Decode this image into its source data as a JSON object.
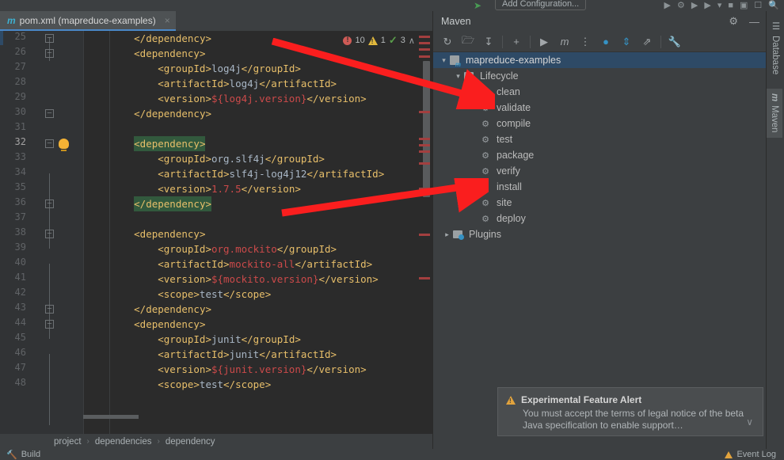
{
  "toolbar": {
    "run_config_label": "Add Configuration...",
    "icons": [
      "run-icon",
      "debug-icon",
      "coverage-icon",
      "profile-icon",
      "dropdown-icon",
      "stop-icon",
      "layout-icon",
      "update-icon",
      "search-icon"
    ]
  },
  "editor": {
    "tab": {
      "icon": "m",
      "title": "pom.xml (mapreduce-examples)",
      "close": "×"
    },
    "inspections": {
      "errors": "10",
      "warnings": "1",
      "checks": "3",
      "up": "∧",
      "down": "∨"
    },
    "first_line": 25,
    "lines": [
      {
        "n": 25,
        "indent": 2,
        "text": "</dependency>"
      },
      {
        "n": 26,
        "indent": 2,
        "text": "<dependency>"
      },
      {
        "n": 27,
        "indent": 3,
        "text": "<groupId>log4j</groupId>"
      },
      {
        "n": 28,
        "indent": 3,
        "text": "<artifactId>log4j</artifactId>"
      },
      {
        "n": 29,
        "indent": 3,
        "text": "<version>${log4j.version}</version>"
      },
      {
        "n": 30,
        "indent": 2,
        "text": "</dependency>"
      },
      {
        "n": 31,
        "indent": 0,
        "text": ""
      },
      {
        "n": 32,
        "indent": 2,
        "text": "<dependency>"
      },
      {
        "n": 33,
        "indent": 3,
        "text": "<groupId>org.slf4j</groupId>"
      },
      {
        "n": 34,
        "indent": 3,
        "text": "<artifactId>slf4j-log4j12</artifactId>"
      },
      {
        "n": 35,
        "indent": 3,
        "text": "<version>1.7.5</version>"
      },
      {
        "n": 36,
        "indent": 2,
        "text": "</dependency>"
      },
      {
        "n": 37,
        "indent": 0,
        "text": ""
      },
      {
        "n": 38,
        "indent": 2,
        "text": "<dependency>"
      },
      {
        "n": 39,
        "indent": 3,
        "text": "<groupId>org.mockito</groupId>"
      },
      {
        "n": 40,
        "indent": 3,
        "text": "<artifactId>mockito-all</artifactId>"
      },
      {
        "n": 41,
        "indent": 3,
        "text": "<version>${mockito.version}</version>"
      },
      {
        "n": 42,
        "indent": 3,
        "text": "<scope>test</scope>"
      },
      {
        "n": 43,
        "indent": 2,
        "text": "</dependency>"
      },
      {
        "n": 44,
        "indent": 2,
        "text": "<dependency>"
      },
      {
        "n": 45,
        "indent": 3,
        "text": "<groupId>junit</groupId>"
      },
      {
        "n": 46,
        "indent": 3,
        "text": "<artifactId>junit</artifactId>"
      },
      {
        "n": 47,
        "indent": 3,
        "text": "<version>${junit.version}</version>"
      },
      {
        "n": 48,
        "indent": 3,
        "text": "<scope>test</scope>"
      }
    ],
    "breadcrumb": [
      "project",
      "dependencies",
      "dependency"
    ],
    "breadcrumb_sep": "›"
  },
  "maven": {
    "title": "Maven",
    "header_buttons": [
      "settings-gear",
      "minimize"
    ],
    "toolbar_icons": [
      "reload-icon",
      "generate-sources-icon",
      "download-sources-icon",
      "add-icon",
      "run-icon",
      "run-maven-goal-icon",
      "toggle-skip-tests-icon",
      "toggle-offline-icon",
      "expand-all-icon",
      "collapse-all-icon",
      "settings-wrench-icon"
    ],
    "tree": {
      "project": "mapreduce-examples",
      "lifecycle": "Lifecycle",
      "goals": [
        "clean",
        "validate",
        "compile",
        "test",
        "package",
        "verify",
        "install",
        "site",
        "deploy"
      ],
      "plugins": "Plugins"
    }
  },
  "right_tool_tabs": [
    {
      "label": "Database",
      "icon": "database-icon"
    },
    {
      "label": "Maven",
      "icon": "m-icon"
    }
  ],
  "notification": {
    "title": "Experimental Feature Alert",
    "body": "You must accept the terms of legal notice of the beta Java specification to enable support…",
    "expand": "∨",
    "icon": "warning-icon"
  },
  "status_bar": {
    "left": "Build",
    "right": "Event Log"
  },
  "colors": {
    "editor_bg": "#2b2b2b",
    "panel_bg": "#3c3f41",
    "tag": "#e8bf6a",
    "value": "#a9b7c6",
    "string_num": "#cc4a4a",
    "highlight": "#32593d",
    "selection": "#2e4a66",
    "accent": "#3592c4",
    "annotation_arrow": "#fa1e1e"
  }
}
